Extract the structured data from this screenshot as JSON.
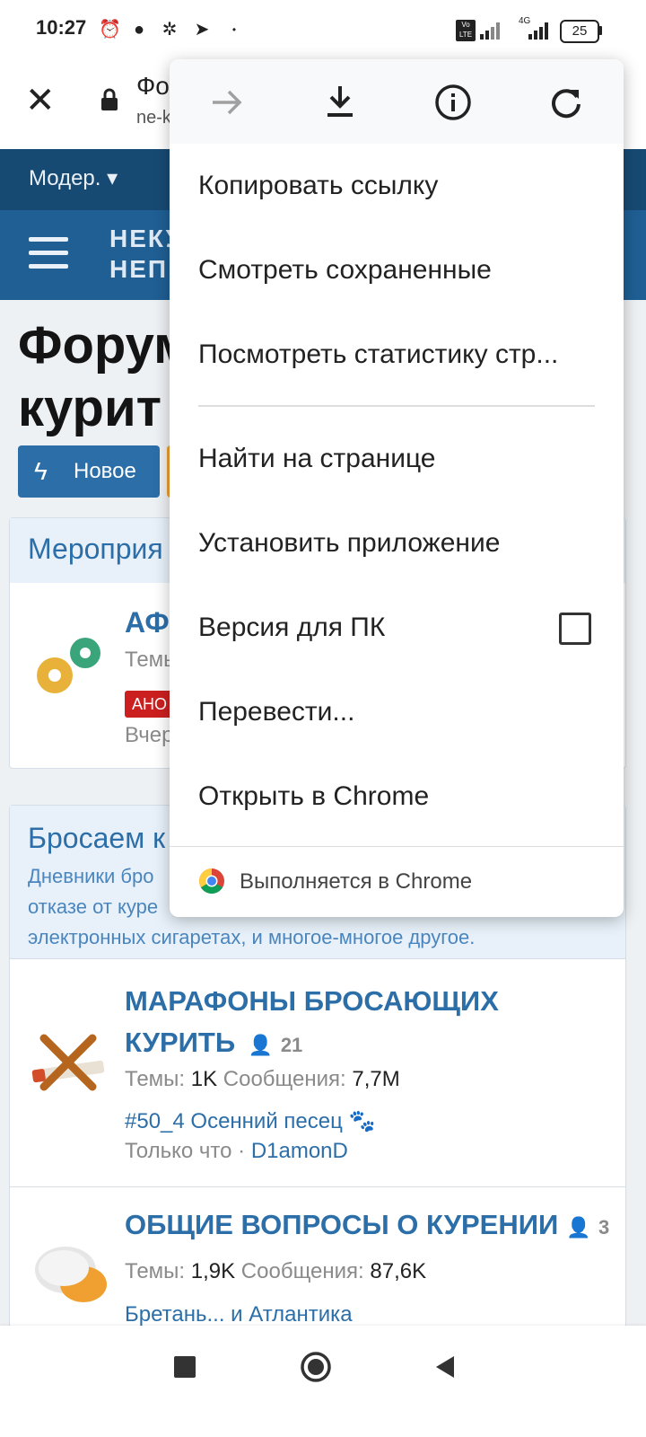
{
  "status_bar": {
    "time": "10:27",
    "battery": "25",
    "network_label_1": "Vo LTE",
    "network_label_2": "4G"
  },
  "browser_bar": {
    "title_fragment": "Фо",
    "url_fragment": "ne-k"
  },
  "forum": {
    "nav_moder": "Модер. ▾",
    "logo_line1": "НЕКУ",
    "logo_line2": "НЕП",
    "page_heading_line1": "Форум",
    "page_heading_line2": "курит",
    "new_button": "Новое",
    "category1": {
      "title": "Мероприя",
      "node_title": "АФ",
      "meta_fragment": "Темь",
      "badge": "АНО",
      "date_fragment": "Вчер"
    },
    "category2": {
      "title": "Бросаем к",
      "desc_line1": "Дневники бро",
      "desc_line2": "отказе от куре",
      "desc_line3": "электронных сигаретах, и многое-многое другое."
    },
    "node_marathons": {
      "title_line1": "МАРАФОНЫ БРОСАЮЩИХ",
      "title_line2": "КУРИТЬ",
      "users": "21",
      "threads_label": "Темы:",
      "threads": "1K",
      "posts_label": "Сообщения:",
      "posts": "7,7M",
      "last_thread": "#50_4 Осенний песец 🐾",
      "last_time": "Только что ·",
      "last_user": "D1amonD"
    },
    "node_general": {
      "title": "ОБЩИЕ ВОПРОСЫ О КУРЕНИИ",
      "users": "3",
      "threads_label": "Темы:",
      "threads": "1,9K",
      "posts_label": "Сообщения:",
      "posts": "87,6K",
      "last_thread": "Бретань... и Атлантика"
    }
  },
  "menu": {
    "items": [
      "Копировать ссылку",
      "Смотреть сохраненные",
      "Посмотреть статистику стр...",
      "Найти на странице",
      "Установить приложение",
      "Версия для ПК",
      "Перевести...",
      "Открыть в Chrome"
    ],
    "footer": "Выполняется в Chrome",
    "desktop_checkbox_checked": false
  },
  "colors": {
    "forum_nav": "#174a73",
    "forum_header": "#1f5f94",
    "link_blue": "#2b6ea8",
    "orange_button": "#f0a030"
  },
  "icons": [
    "forward-icon",
    "download-icon",
    "info-icon",
    "reload-icon",
    "close-icon",
    "lock-icon",
    "chrome-icon",
    "stop-icon",
    "home-icon",
    "back-icon"
  ]
}
